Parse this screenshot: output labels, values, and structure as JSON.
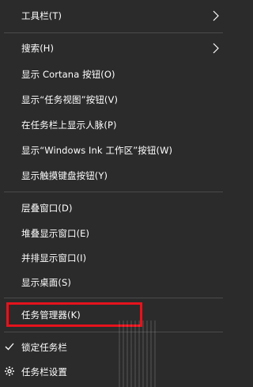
{
  "menu": {
    "items": [
      {
        "label": "工具栏(T)"
      },
      {
        "label": "搜索(H)"
      },
      {
        "label": "显示 Cortana 按钮(O)"
      },
      {
        "label": "显示“任务视图”按钮(V)"
      },
      {
        "label": "在任务栏上显示人脉(P)"
      },
      {
        "label": "显示“Windows Ink 工作区”按钮(W)"
      },
      {
        "label": "显示触摸键盘按钮(Y)"
      },
      {
        "label": "层叠窗口(D)"
      },
      {
        "label": "堆叠显示窗口(E)"
      },
      {
        "label": "并排显示窗口(I)"
      },
      {
        "label": "显示桌面(S)"
      },
      {
        "label": "任务管理器(K)"
      },
      {
        "label": "锁定任务栏"
      },
      {
        "label": "任务栏设置"
      }
    ]
  },
  "colors": {
    "background": "#2b2b2b",
    "text": "#ffffff",
    "divider": "#4a4a4a",
    "highlight": "#e5131c"
  },
  "icons": {
    "submenu": "chevron-right-icon",
    "locked": "checkmark-icon",
    "settings": "gear-icon"
  }
}
